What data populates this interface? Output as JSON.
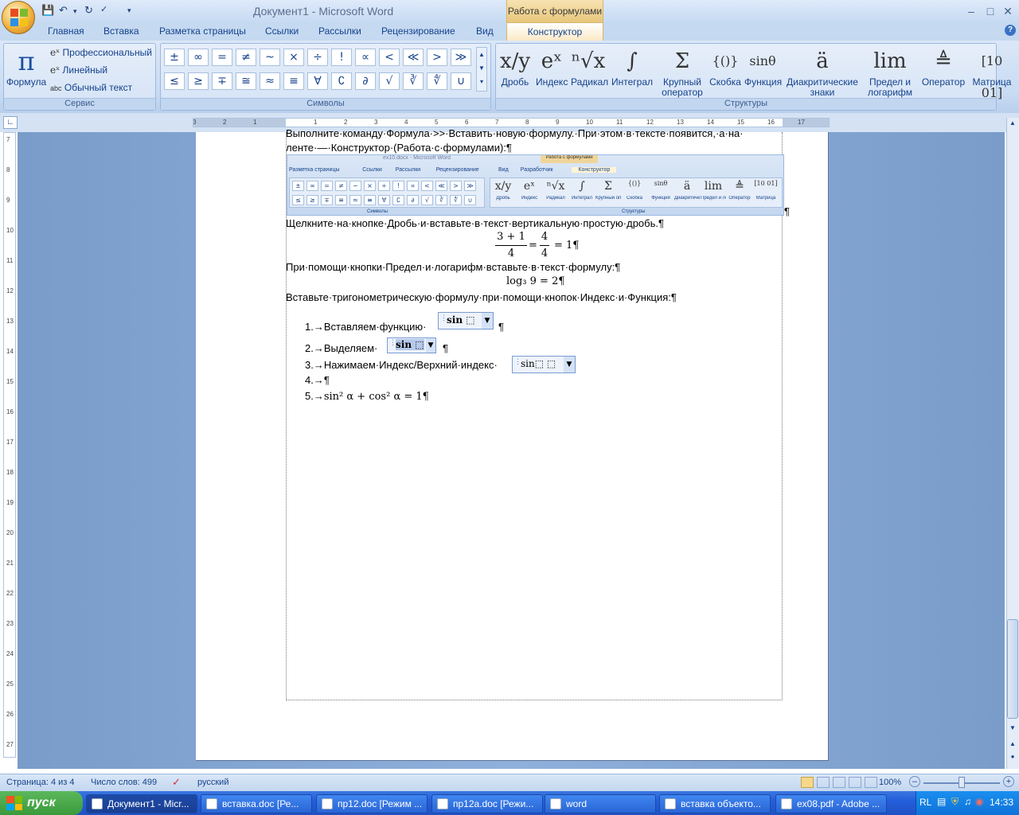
{
  "title": {
    "doc": "Документ1 - Microsoft Word",
    "context_tab": "Работа с формулами"
  },
  "tabs": [
    "Главная",
    "Вставка",
    "Разметка страницы",
    "Ссылки",
    "Рассылки",
    "Рецензирование",
    "Вид",
    "Конструктор"
  ],
  "ribbon": {
    "service": {
      "formula": "Формула",
      "professional": "Профессиональный",
      "linear": "Линейный",
      "plain_text": "Обычный текст",
      "label": "Сервис"
    },
    "symbols": {
      "row1": [
        "±",
        "∞",
        "=",
        "≠",
        "~",
        "×",
        "÷",
        "!",
        "∝",
        "<",
        "≪",
        ">",
        "≫"
      ],
      "row2": [
        "≤",
        "≥",
        "∓",
        "≅",
        "≈",
        "≡",
        "∀",
        "∁",
        "∂",
        "√",
        "∛",
        "∜",
        "∪"
      ],
      "label": "Символы"
    },
    "structures": {
      "items": [
        {
          "icon": "x/y",
          "label": "Дробь"
        },
        {
          "icon": "eˣ",
          "label": "Индекс"
        },
        {
          "icon": "ⁿ√x",
          "label": "Радикал"
        },
        {
          "icon": "∫",
          "label": "Интеграл"
        },
        {
          "icon": "Σ",
          "label": "Крупный оператор"
        },
        {
          "icon": "{()}",
          "label": "Скобка"
        },
        {
          "icon": "sinθ",
          "label": "Функция"
        },
        {
          "icon": "ä",
          "label": "Диакритические знаки"
        },
        {
          "icon": "lim",
          "label": "Предел и логарифм"
        },
        {
          "icon": "≜",
          "label": "Оператор"
        },
        {
          "icon": "[10 01]",
          "label": "Матрица"
        }
      ],
      "label": "Структуры"
    }
  },
  "document": {
    "line1": "Выполните·команду·Формула·>>·Вставить·новую·формулу.·При·этом·в·тексте·появится,·а·на·",
    "line2": "ленте·—·Конструктор·(Работа·с·формулами):¶",
    "embed": {
      "title": "ex10.docx - Microsoft Word",
      "ctx": "Работа с формулами",
      "tabs": [
        "Разметка страницы",
        "Ссылки",
        "Рассылки",
        "Рецензирование",
        "Вид",
        "Разработчик",
        "Конструктор"
      ],
      "symbols_label": "Символы",
      "structures_label": "Структуры",
      "struct_items": [
        "Дробь",
        "Индекс",
        "Радикал",
        "Интеграл",
        "Крупный оператор",
        "Скобка",
        "Функция",
        "Диакритические знаки",
        "Предел и логарифм",
        "Оператор",
        "Матрица"
      ]
    },
    "pilcrow_after_embed": "¶",
    "line3": "Щелкните·на·кнопке·Дробь·и·вставьте·в·текст·вертикальную·простую·дробь.¶",
    "fraction": {
      "num1": "3 + 1",
      "den1": "4",
      "num2": "4",
      "den2": "4",
      "rest": "= 1¶"
    },
    "line4": "При·помощи·кнопки·Предел·и·логарифм·вставьте·в·текст·формулу:¶",
    "log_formula": "log₃ 9 = 2¶",
    "line5": "Вставьте·тригонометрическую·формулу·при·помощи·кнопок·Индекс·и·Функция:¶",
    "list": [
      {
        "num": "1.→",
        "text": "Вставляем·функцию·",
        "eq": "sin ⬚",
        "end": "¶"
      },
      {
        "num": "2.→",
        "text": "Выделяем·",
        "eq": "sin ⬚",
        "end": "¶"
      },
      {
        "num": "3.→",
        "text": "Нажимаем·Индекс/Верхний·индекс·",
        "eq": "sin⬚ ⬚",
        "end": ""
      },
      {
        "num": "4.→",
        "text": "¶",
        "eq": "",
        "end": ""
      },
      {
        "num": "5.→",
        "text": "sin² α + cos² α = 1¶",
        "eq": "",
        "end": ""
      }
    ]
  },
  "status": {
    "page": "Страница: 4 из 4",
    "words": "Число слов: 499",
    "lang": "русский",
    "zoom": "100%"
  },
  "taskbar": {
    "start": "пуск",
    "tasks": [
      "Документ1 - Micr...",
      "вставка.doc [Ре...",
      "пр12.doc [Режим ...",
      "пр12a.doc [Режи...",
      "word",
      "вставка объекто...",
      "ex08.pdf - Adobe ..."
    ],
    "tray_lang": "RL",
    "clock": "14:33"
  }
}
